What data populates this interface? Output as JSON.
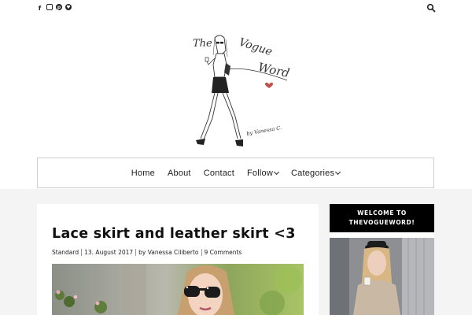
{
  "social_icons": [
    "facebook-icon",
    "instagram-icon",
    "pinterest-icon",
    "bloglovin-icon"
  ],
  "logo": {
    "word1": "The",
    "word2": "Vogue",
    "word3": "Word",
    "signature": "by Vanessa C."
  },
  "nav": {
    "items": [
      {
        "label": "Home",
        "has_dropdown": false
      },
      {
        "label": "About",
        "has_dropdown": false
      },
      {
        "label": "Contact",
        "has_dropdown": false
      },
      {
        "label": "Follow",
        "has_dropdown": true
      },
      {
        "label": "Categories",
        "has_dropdown": true
      }
    ]
  },
  "post": {
    "title": "Lace skirt and leather skirt <3",
    "category": "Standard",
    "date": "13. August 2017",
    "author": "by Vanessa Ciliberto",
    "comments": "9 Comments"
  },
  "widget": {
    "title_line1": "WELCOME TO",
    "title_line2": "THEVOGUEWORD!"
  },
  "colors": {
    "text": "#222222",
    "nav_border": "#cfcfcf",
    "content_bg": "#f4f4f4",
    "widget_head": "#000000",
    "heart": "#c0504d"
  }
}
